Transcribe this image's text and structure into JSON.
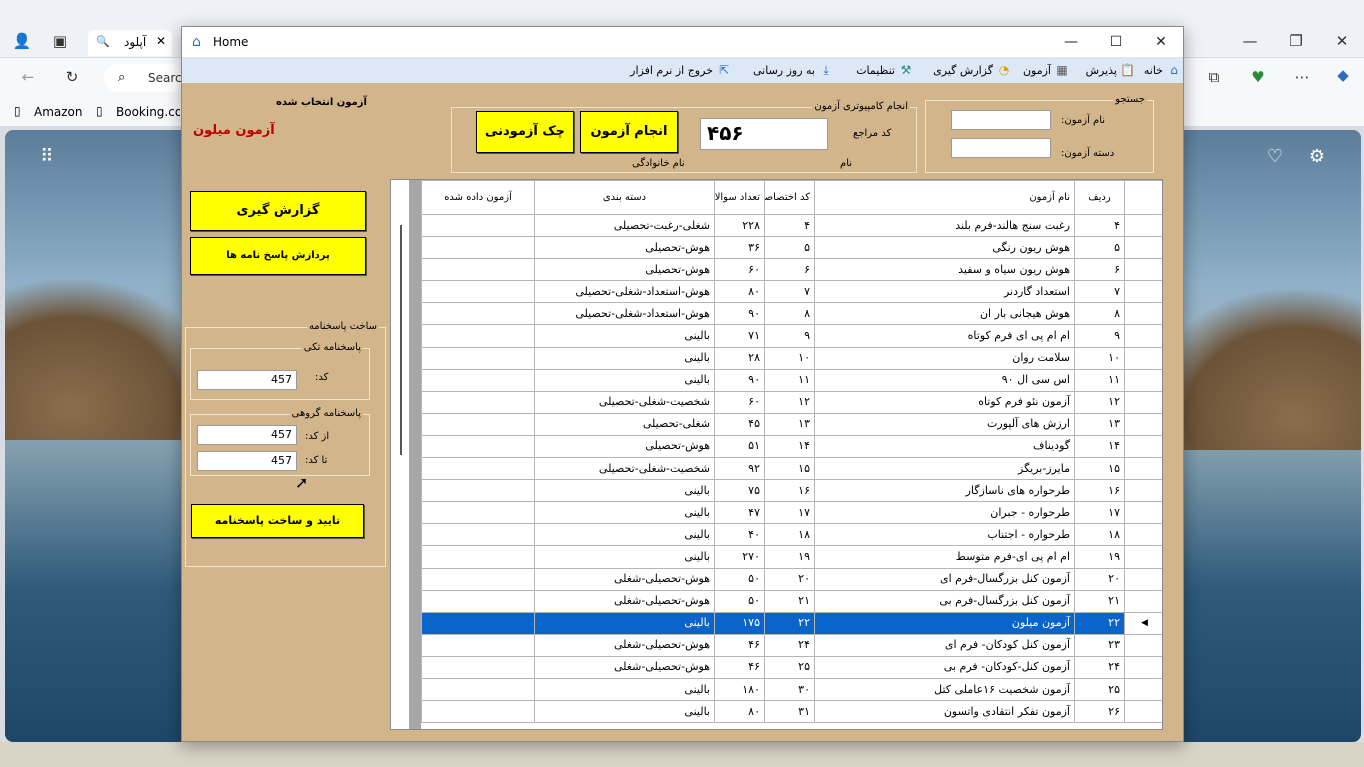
{
  "browser": {
    "tab_title": "آپلود",
    "search_placeholder": "Search",
    "bookmarks": [
      "Amazon",
      "Booking.com"
    ]
  },
  "window": {
    "title": "Home",
    "controls": {
      "minimize": "—",
      "maximize": "☐",
      "close": "✕"
    }
  },
  "menu": [
    {
      "label": "خانه",
      "icon": "home-icon"
    },
    {
      "label": "پذیرش",
      "icon": "clipboard-icon"
    },
    {
      "label": "آزمون",
      "icon": "test-icon"
    },
    {
      "label": "گزارش گیری",
      "icon": "pie-chart-icon"
    },
    {
      "label": "تنظیمات",
      "icon": "tools-icon"
    },
    {
      "label": "به روز رسانی",
      "icon": "download-icon"
    },
    {
      "label": "خروج از نرم افزار",
      "icon": "exit-icon"
    }
  ],
  "search_box": {
    "title": "جستجو",
    "name_label": "نام آزمون:",
    "category_label": "دسته آزمون:",
    "name_value": "",
    "category_value": ""
  },
  "computer_test": {
    "title": "انجام کامپیوتری آزمون",
    "ref_code_label": "کد مراجع",
    "ref_code_value": "۴۵۶",
    "first_name_label": "نام",
    "last_name_label": "نام خانوادگی",
    "run_button": "انجام آزمون",
    "checklist_button": "چک آزمودنی"
  },
  "selected_test": {
    "label": "آزمون انتخاب شده",
    "value": "آزمون میلون"
  },
  "left_buttons": {
    "report": "گزارش گیری",
    "process": "پردازش پاسخ نامه ها"
  },
  "answer_sheet": {
    "title": "ساخت پاسخنامه",
    "single": {
      "title": "پاسخنامه تکی",
      "code_label": "کد:",
      "code_value": "457"
    },
    "group": {
      "title": "پاسخنامه گروهی",
      "from_label": "از کد:",
      "from_value": "457",
      "to_label": "تا کد:",
      "to_value": "457"
    },
    "confirm_button": "تایید و ساخت پاسخنامه"
  },
  "grid": {
    "headers": [
      "ردیف",
      "نام آزمون",
      "کد اختصاصی",
      "تعداد سوالات",
      "دسته بندی",
      "آزمون داده شده"
    ],
    "selected_index": 18,
    "rows": [
      [
        "۴",
        "رغبت سنج هالند-فرم بلند",
        "۴",
        "۲۲۸",
        "شغلی-رغبت-تحصیلی",
        ""
      ],
      [
        "۵",
        "هوش ریون رنگی",
        "۵",
        "۳۶",
        "هوش-تحصیلی",
        ""
      ],
      [
        "۶",
        "هوش ریون سیاه و سفید",
        "۶",
        "۶۰",
        "هوش-تحصیلی",
        ""
      ],
      [
        "۷",
        "استعداد گاردنر",
        "۷",
        "۸۰",
        "هوش-استعداد-شغلی-تحصیلی",
        ""
      ],
      [
        "۸",
        "هوش هیجانی بار ان",
        "۸",
        "۹۰",
        "هوش-استعداد-شغلی-تحصیلی",
        ""
      ],
      [
        "۹",
        "ام ام پی ای فرم کوتاه",
        "۹",
        "۷۱",
        "بالینی",
        ""
      ],
      [
        "۱۰",
        "سلامت روان",
        "۱۰",
        "۲۸",
        "بالینی",
        ""
      ],
      [
        "۱۱",
        "اس سی ال ۹۰",
        "۱۱",
        "۹۰",
        "بالینی",
        ""
      ],
      [
        "۱۲",
        "آزمون نئو فرم کوتاه",
        "۱۲",
        "۶۰",
        "شخصیت-شغلی-تحصیلی",
        ""
      ],
      [
        "۱۳",
        "ارزش های آلپورت",
        "۱۳",
        "۴۵",
        "شغلی-تحصیلی",
        ""
      ],
      [
        "۱۴",
        "گودیناف",
        "۱۴",
        "۵۱",
        "هوش-تحصیلی",
        ""
      ],
      [
        "۱۵",
        "مایرز-بریگز",
        "۱۵",
        "۹۲",
        "شخصیت-شغلی-تحصیلی",
        ""
      ],
      [
        "۱۶",
        "طرحواره های ناسازگار",
        "۱۶",
        "۷۵",
        "بالینی",
        ""
      ],
      [
        "۱۷",
        "طرحواره - جبران",
        "۱۷",
        "۴۷",
        "بالینی",
        ""
      ],
      [
        "۱۸",
        "طرحواره - اجتناب",
        "۱۸",
        "۴۰",
        "بالینی",
        ""
      ],
      [
        "۱۹",
        "ام ام پی ای-فرم متوسط",
        "۱۹",
        "۲۷۰",
        "بالینی",
        ""
      ],
      [
        "۲۰",
        "آزمون کنل بزرگسال-فرم ای",
        "۲۰",
        "۵۰",
        "هوش-تحصیلی-شغلی",
        ""
      ],
      [
        "۲۱",
        "آزمون کنل بزرگسال-فرم بی",
        "۲۱",
        "۵۰",
        "هوش-تحصیلی-شغلی",
        ""
      ],
      [
        "۲۲",
        "آزمون میلون",
        "۲۲",
        "۱۷۵",
        "بالینی",
        ""
      ],
      [
        "۲۳",
        "آزمون کنل کودکان- فرم ای",
        "۲۴",
        "۴۶",
        "هوش-تحصیلی-شغلی",
        ""
      ],
      [
        "۲۴",
        "آزمون کنل-کودکان- فرم بی",
        "۲۵",
        "۴۶",
        "هوش-تحصیلی-شغلی",
        ""
      ],
      [
        "۲۵",
        "آزمون شخصیت ۱۶عاملی کتل",
        "۳۰",
        "۱۸۰",
        "بالینی",
        ""
      ],
      [
        "۲۶",
        "آزمون تفکر انتقادی واتسون",
        "۳۱",
        "۸۰",
        "بالینی",
        ""
      ]
    ]
  },
  "colors": {
    "app_background": "#d3b58c",
    "button_yellow": "#ffff00",
    "selection_blue": "#0a64c9",
    "selected_test_text": "#c00000",
    "menubar": "#dce8f5"
  }
}
